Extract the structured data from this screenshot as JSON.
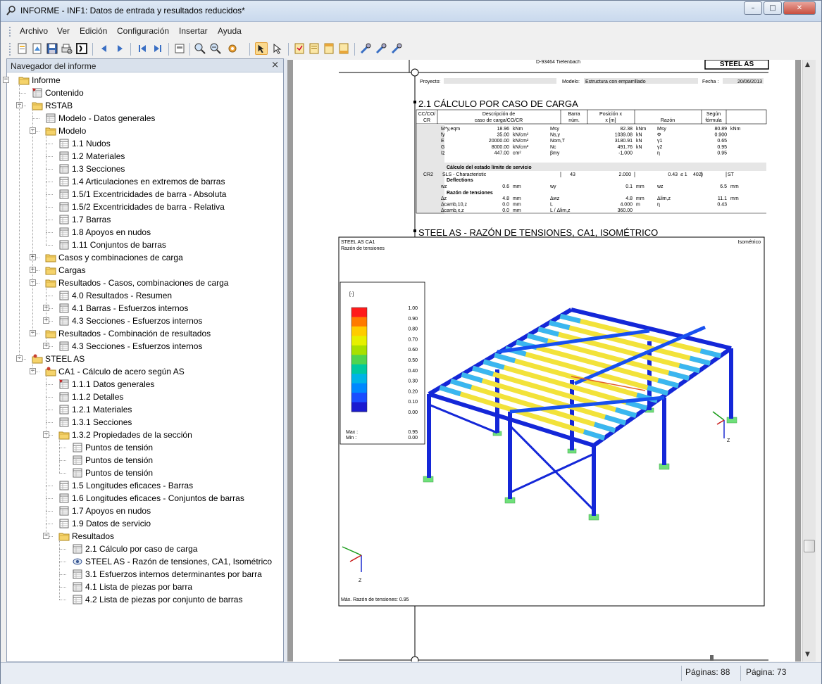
{
  "window": {
    "title": "INFORME - INF1: Datos de entrada y resultados reducidos*",
    "min": "–",
    "max": "□",
    "close": "✕"
  },
  "menu": [
    "Archivo",
    "Ver",
    "Edición",
    "Configuración",
    "Insertar",
    "Ayuda"
  ],
  "toolbar_icons": [
    "new-report-icon",
    "open-icon",
    "save-icon",
    "print-preview-icon",
    "print-icon",
    "refresh-icon",
    "prev-page-icon",
    "next-page-icon",
    "first-page-icon",
    "last-page-icon",
    "page-setup-icon",
    "zoom-icon",
    "zoom-out-icon",
    "settings-icon",
    "select-icon",
    "pointer-icon",
    "cover-sheet-icon",
    "page-icon",
    "header-icon",
    "footer-icon",
    "tools-icon",
    "tools2-icon",
    "tools3-icon"
  ],
  "navigator": {
    "title": "Navegador del informe",
    "close": "×",
    "items": [
      {
        "label": "Informe",
        "level": 0,
        "icon": "folder",
        "exp": "-"
      },
      {
        "label": "Contenido",
        "level": 1,
        "icon": "table-red"
      },
      {
        "label": "RSTAB",
        "level": 1,
        "icon": "folder",
        "exp": "-"
      },
      {
        "label": "Modelo - Datos generales",
        "level": 2,
        "icon": "table"
      },
      {
        "label": "Modelo",
        "level": 2,
        "icon": "folder",
        "exp": "-"
      },
      {
        "label": "1.1 Nudos",
        "level": 3,
        "icon": "table"
      },
      {
        "label": "1.2 Materiales",
        "level": 3,
        "icon": "table"
      },
      {
        "label": "1.3 Secciones",
        "level": 3,
        "icon": "table"
      },
      {
        "label": "1.4 Articulaciones en extremos de barras",
        "level": 3,
        "icon": "table"
      },
      {
        "label": "1.5/1 Excentricidades de barra - Absoluta",
        "level": 3,
        "icon": "table"
      },
      {
        "label": "1.5/2 Excentricidades de barra - Relativa",
        "level": 3,
        "icon": "table"
      },
      {
        "label": "1.7 Barras",
        "level": 3,
        "icon": "table"
      },
      {
        "label": "1.8 Apoyos en nudos",
        "level": 3,
        "icon": "table"
      },
      {
        "label": "1.11 Conjuntos de barras",
        "level": 3,
        "icon": "table"
      },
      {
        "label": "Casos y combinaciones de carga",
        "level": 2,
        "icon": "folder",
        "exp": "+"
      },
      {
        "label": "Cargas",
        "level": 2,
        "icon": "folder",
        "exp": "+"
      },
      {
        "label": "Resultados - Casos, combinaciones de carga",
        "level": 2,
        "icon": "folder",
        "exp": "-"
      },
      {
        "label": "4.0 Resultados - Resumen",
        "level": 3,
        "icon": "table"
      },
      {
        "label": "4.1 Barras - Esfuerzos internos",
        "level": 3,
        "icon": "table",
        "exp": "+"
      },
      {
        "label": "4.3 Secciones - Esfuerzos internos",
        "level": 3,
        "icon": "table",
        "exp": "+"
      },
      {
        "label": "Resultados - Combinación de resultados",
        "level": 2,
        "icon": "folder",
        "exp": "-"
      },
      {
        "label": "4.3 Secciones - Esfuerzos internos",
        "level": 3,
        "icon": "table",
        "exp": "+"
      },
      {
        "label": "STEEL AS",
        "level": 1,
        "icon": "folder-tool",
        "exp": "-"
      },
      {
        "label": "CA1 - Cálculo de acero según AS",
        "level": 2,
        "icon": "folder-tool",
        "exp": "-"
      },
      {
        "label": "1.1.1 Datos generales",
        "level": 3,
        "icon": "table-red"
      },
      {
        "label": "1.1.2 Detalles",
        "level": 3,
        "icon": "table"
      },
      {
        "label": "1.2.1 Materiales",
        "level": 3,
        "icon": "table"
      },
      {
        "label": "1.3.1 Secciones",
        "level": 3,
        "icon": "table"
      },
      {
        "label": "1.3.2 Propiedades de la sección",
        "level": 3,
        "icon": "folder",
        "exp": "-"
      },
      {
        "label": "Puntos de tensión",
        "level": 4,
        "icon": "table"
      },
      {
        "label": "Puntos de tensión",
        "level": 4,
        "icon": "table"
      },
      {
        "label": "Puntos de tensión",
        "level": 4,
        "icon": "table"
      },
      {
        "label": "1.5 Longitudes eficaces - Barras",
        "level": 3,
        "icon": "table"
      },
      {
        "label": "1.6 Longitudes eficaces - Conjuntos de barras",
        "level": 3,
        "icon": "table"
      },
      {
        "label": "1.7 Apoyos en nudos",
        "level": 3,
        "icon": "table"
      },
      {
        "label": "1.9 Datos de servicio",
        "level": 3,
        "icon": "table"
      },
      {
        "label": "Resultados",
        "level": 3,
        "icon": "folder",
        "exp": "-"
      },
      {
        "label": "2.1 Cálculo por caso de carga",
        "level": 4,
        "icon": "table"
      },
      {
        "label": "STEEL AS -  Razón de tensiones, CA1, Isométrico",
        "level": 4,
        "icon": "eye"
      },
      {
        "label": "3.1 Esfuerzos internos determinantes por barra",
        "level": 4,
        "icon": "table"
      },
      {
        "label": "4.1 Lista de piezas por barra",
        "level": 4,
        "icon": "table"
      },
      {
        "label": "4.2 Lista de piezas por conjunto de barras",
        "level": 4,
        "icon": "table"
      }
    ]
  },
  "report": {
    "header": {
      "steel_as": "STEEL AS",
      "top_text": "D-93464 Tiefenbach",
      "proyecto_label": "Proyecto:",
      "modelo_label": "Modelo:",
      "modelo_value": "Estructura con emparrillado",
      "fecha_label": "Fecha :",
      "fecha_value": "20/06/2013"
    },
    "section1_title": "2.1 CÁLCULO POR CASO DE CARGA",
    "table_headers": [
      "CC/CO/\nCR",
      "Descripción de\ncaso de carga/CO/CR",
      "Barra\nnúm.",
      "Posición x\nx [m]",
      "Razón",
      "Según\nfórmula"
    ],
    "rows_a": [
      [
        "M*y,eqm",
        "18.96",
        "kNm",
        "Msy",
        "82.38",
        "kNm",
        "Msy",
        "80.89",
        "kNm"
      ],
      [
        "fy",
        "35.00",
        "kN/cm²",
        "Ns,y",
        "1039.08",
        "kN",
        "Φ",
        "0.900",
        ""
      ],
      [
        "E",
        "20000.00",
        "kN/cm²",
        "Nom,T",
        "3180.91",
        "kN",
        "γ1",
        "0.65",
        ""
      ],
      [
        "G",
        "8000.00",
        "kN/cm²",
        "Nc",
        "491.76",
        "kN",
        "γ2",
        "0.95",
        ""
      ],
      [
        "Iz",
        "447.00",
        "cm²",
        "βmy",
        "-1.000",
        "",
        "η",
        "0.95",
        ""
      ]
    ],
    "serv_title": "Cálculo del estado límite de servicio",
    "cr": "CR2",
    "serv_row": [
      "SLS - Characteristic",
      "43",
      "2.000",
      "0.43",
      "≤ 1",
      "402)",
      "ST"
    ],
    "deflections": "Deflections",
    "defl_row": [
      "wz",
      "0.6",
      "mm",
      "wy",
      "0.1",
      "mm",
      "wz",
      "6.5",
      "mm"
    ],
    "razon_title": "Razón de tensiones",
    "rows_b": [
      [
        "Δz",
        "4.8",
        "mm",
        "Δwz",
        "4.8",
        "mm",
        "Δlim,z",
        "11.1",
        "mm"
      ],
      [
        "Δcamb,10,z",
        "0.0",
        "mm",
        "L",
        "4.000",
        "m",
        "η",
        "0.43",
        ""
      ],
      [
        "Δcamb,x,z",
        "0.0",
        "mm",
        "L / Δlim,z",
        "360.00",
        "",
        "",
        "",
        ""
      ]
    ],
    "section2_title": "STEEL AS -  RAZÓN DE TENSIONES, CA1, ISOMÉTRICO",
    "graphic": {
      "line1": "STEEL AS CA1",
      "line2": "Razón de tensiones",
      "view": "Isométrico",
      "legend_unit": "[-]",
      "legend_values": [
        "1.00",
        "0.90",
        "0.80",
        "0.70",
        "0.60",
        "0.50",
        "0.40",
        "0.30",
        "0.20",
        "0.10",
        "0.00"
      ],
      "max_label": "Max :",
      "max_value": "0.95",
      "min_label": "Min :",
      "min_value": "0.00",
      "footer": "Máx. Razón de tensiones: 0.95",
      "axis_z": "Z"
    }
  },
  "status": {
    "pages_label": "Páginas: 88",
    "page_label": "Página: 73"
  }
}
